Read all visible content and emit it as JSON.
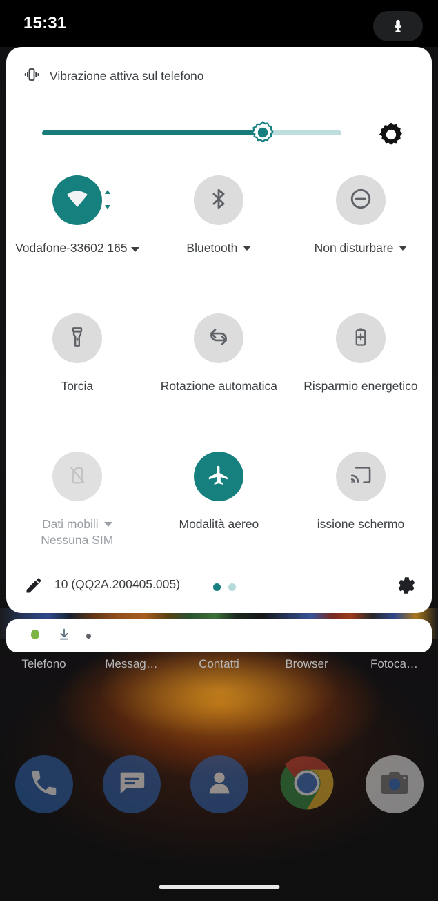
{
  "status_bar": {
    "clock": "15:31",
    "mic_icon": "microphone-icon"
  },
  "quick_settings": {
    "ringer_status": "Vibrazione attiva sul telefono",
    "ringer_icon": "vibration-icon",
    "brightness": {
      "icon": "brightness-icon",
      "value_percent": 72
    },
    "tiles": [
      [
        {
          "label": "Vodafone-33602 165",
          "icon": "wifi-icon",
          "state": "on",
          "has_caret": true,
          "sub": ""
        },
        {
          "label": "Bluetooth",
          "icon": "bluetooth-icon",
          "state": "off",
          "has_caret": true,
          "sub": ""
        },
        {
          "label": "Non disturbare",
          "icon": "do-not-disturb-icon",
          "state": "off",
          "has_caret": true,
          "sub": ""
        }
      ],
      [
        {
          "label": "Torcia",
          "icon": "flashlight-icon",
          "state": "off",
          "has_caret": false,
          "sub": ""
        },
        {
          "label": "Rotazione automatica",
          "icon": "auto-rotate-icon",
          "state": "off",
          "has_caret": false,
          "sub": ""
        },
        {
          "label": "Risparmio energetico",
          "icon": "battery-saver-icon",
          "state": "off",
          "has_caret": false,
          "sub": ""
        }
      ],
      [
        {
          "label": "Dati mobili",
          "icon": "no-sim-icon",
          "state": "disabled",
          "has_caret": true,
          "sub": "Nessuna SIM"
        },
        {
          "label": "Modalità aereo",
          "icon": "airplane-icon",
          "state": "on",
          "has_caret": false,
          "sub": ""
        },
        {
          "label": "issione schermo",
          "icon": "cast-icon",
          "state": "off",
          "has_caret": false,
          "sub": ""
        }
      ]
    ],
    "footer": {
      "edit_icon": "pencil-icon",
      "build_text": "10 (QQ2A.200405.005)",
      "settings_icon": "gear-icon",
      "page_dots": 2,
      "active_page": 0
    }
  },
  "notification_strip": {
    "icons": [
      "android-bug-icon",
      "download-icon",
      "more-dot-icon"
    ]
  },
  "home": {
    "app_labels": [
      "Telefono",
      "Messag…",
      "Contatti",
      "Browser",
      "Fotoca…"
    ],
    "dock": [
      {
        "name": "Telefono",
        "icon": "phone-icon"
      },
      {
        "name": "Messaggi",
        "icon": "messages-icon"
      },
      {
        "name": "Contatti",
        "icon": "contacts-icon"
      },
      {
        "name": "Browser",
        "icon": "chrome-icon"
      },
      {
        "name": "Fotocamera",
        "icon": "camera-icon"
      }
    ]
  },
  "colors": {
    "accent_teal": "#16807f",
    "slider_track": "#bedede",
    "tile_off": "#dcdcdc",
    "text_primary": "#3c4043",
    "text_dim": "#9aa0a6",
    "panel_bg": "#ffffff",
    "status_bar_bg": "#000000"
  }
}
